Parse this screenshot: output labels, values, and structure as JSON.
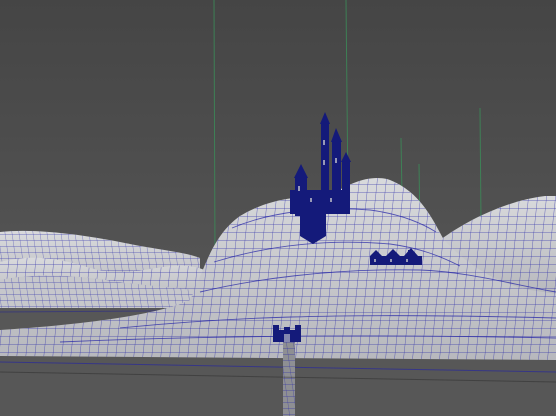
{
  "viewport": {
    "background_gradient": [
      "#454545",
      "#5c5c5c"
    ],
    "mesh_fill": "#cfd0d2",
    "wire_color": "#1f1fa6",
    "model_color": "#141a7a",
    "guide_line_color": "#3c8a58",
    "ground_color": "#575757"
  }
}
